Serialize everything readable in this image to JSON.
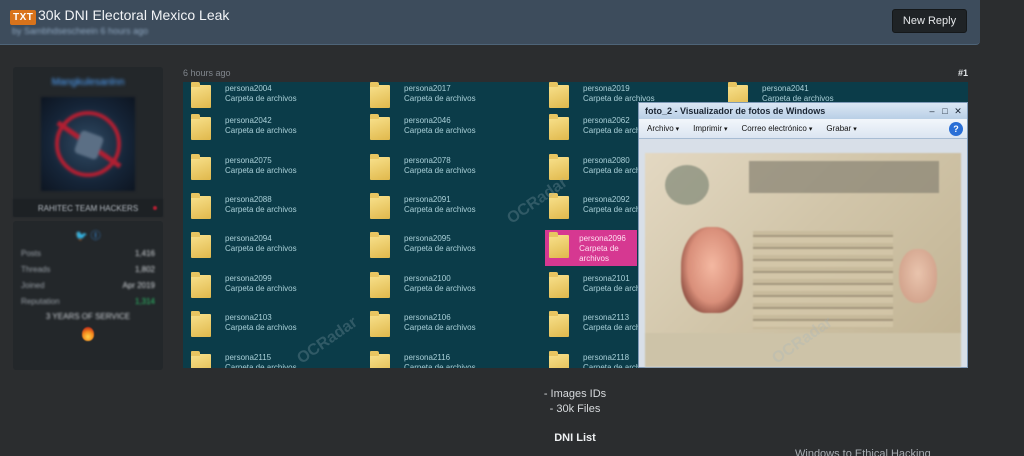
{
  "thread": {
    "badge": "TXT",
    "title": "30k DNI Electoral Mexico Leak",
    "meta": "by Sambhdsescheein 6 hours ago",
    "new_reply": "New Reply"
  },
  "author": {
    "name": "Mangkulesanlnn",
    "usertitle": "RAHITEC TEAM HACKERS",
    "social": "🐦 Ⓘ",
    "stats": [
      {
        "label": "Posts",
        "value": "1,416"
      },
      {
        "label": "Threads",
        "value": "1,802"
      },
      {
        "label": "Joined",
        "value": "Apr 2019"
      },
      {
        "label": "Reputation",
        "value": "1,314"
      }
    ],
    "service": "3 YEARS OF SERVICE"
  },
  "post": {
    "time": "6 hours ago",
    "number": "#1",
    "caption_lines": [
      "- Images IDs",
      "- 30k Files"
    ],
    "dni_list": "DNI List",
    "cutoff_text": "Windows to Ethical Hacking"
  },
  "explorer": {
    "folder_type": "Carpeta de archivos",
    "rows": [
      [
        "persona2004",
        "persona2017",
        "persona2019",
        "persona2041"
      ],
      [
        "persona2042",
        "persona2046",
        "persona2062",
        ""
      ],
      [
        "persona2075",
        "persona2078",
        "persona2080",
        ""
      ],
      [
        "persona2088",
        "persona2091",
        "persona2092",
        ""
      ],
      [
        "persona2094",
        "persona2095",
        "persona2096",
        ""
      ],
      [
        "persona2099",
        "persona2100",
        "persona2101",
        ""
      ],
      [
        "persona2103",
        "persona2106",
        "persona2113",
        ""
      ],
      [
        "persona2115",
        "persona2116",
        "persona2118",
        ""
      ]
    ],
    "selected": "persona2096"
  },
  "viewer": {
    "title": "foto_2 - Visualizador de fotos de Windows",
    "menu": [
      "Archivo",
      "Imprimir",
      "Correo electrónico",
      "Grabar"
    ],
    "help": "?"
  },
  "watermark": "OCRadar",
  "colors": {
    "accent": "#d9731b",
    "header_bg": "#3d4c5c",
    "selection": "#d63891",
    "explorer_bg": "#0b3c49"
  }
}
